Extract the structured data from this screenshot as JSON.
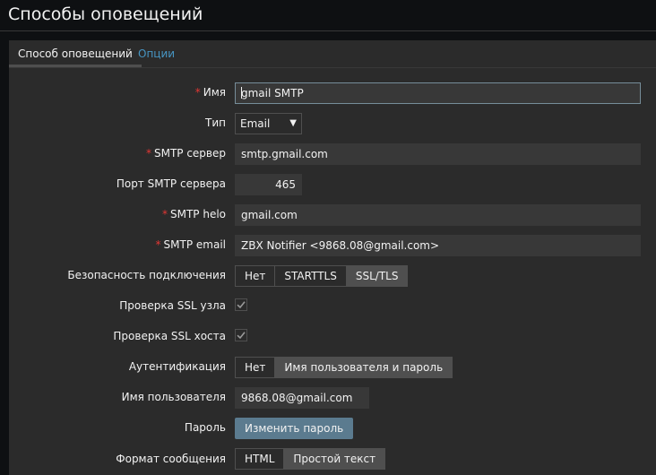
{
  "header": {
    "title": "Способы оповещений"
  },
  "tabs": [
    {
      "label": "Способ оповещений"
    },
    {
      "label": "Опции"
    }
  ],
  "form": {
    "name": {
      "label": "Имя",
      "value": "gmail SMTP"
    },
    "type": {
      "label": "Тип",
      "value": "Email"
    },
    "smtp_server": {
      "label": "SMTP сервер",
      "value": "smtp.gmail.com"
    },
    "smtp_port": {
      "label": "Порт SMTP сервера",
      "value": "465"
    },
    "smtp_helo": {
      "label": "SMTP helo",
      "value": "gmail.com"
    },
    "smtp_email": {
      "label": "SMTP email",
      "value": "ZBX Notifier <9868.08@gmail.com>"
    },
    "security": {
      "label": "Безопасность подключения",
      "options": [
        "Нет",
        "STARTTLS",
        "SSL/TLS"
      ],
      "selected": "SSL/TLS"
    },
    "verify_peer": {
      "label": "Проверка SSL узла",
      "checked": true
    },
    "verify_host": {
      "label": "Проверка SSL хоста",
      "checked": true
    },
    "auth": {
      "label": "Аутентификация",
      "options": [
        "Нет",
        "Имя пользователя и пароль"
      ],
      "selected": "Имя пользователя и пароль"
    },
    "username": {
      "label": "Имя пользователя",
      "value": "9868.08@gmail.com"
    },
    "password": {
      "label": "Пароль",
      "button": "Изменить пароль"
    },
    "format": {
      "label": "Формат сообщения",
      "options": [
        "HTML",
        "Простой текст"
      ],
      "selected": "Простой текст"
    }
  },
  "colors": {
    "accent": "#4796c4",
    "required": "#e33734",
    "button": "#5b7b8f"
  }
}
